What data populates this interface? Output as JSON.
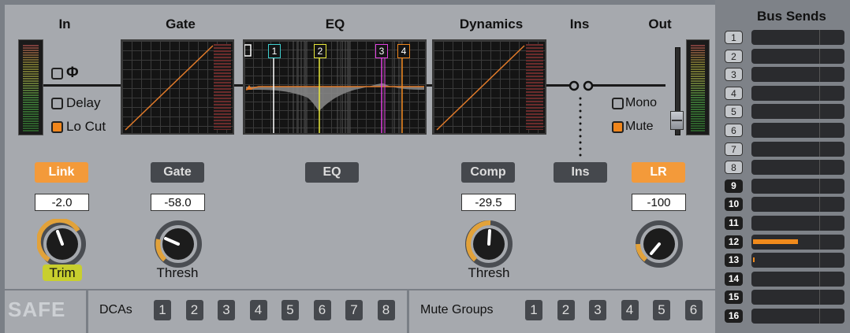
{
  "headers": {
    "in": "In",
    "gate": "Gate",
    "eq": "EQ",
    "dynamics": "Dynamics",
    "ins": "Ins",
    "out": "Out",
    "bus_sends": "Bus Sends"
  },
  "checkboxes": {
    "phase": {
      "label": "Φ",
      "on": false
    },
    "delay": {
      "label": "Delay",
      "on": false
    },
    "lo_cut": {
      "label": "Lo Cut",
      "on": true
    },
    "mono": {
      "label": "Mono",
      "on": false
    },
    "mute": {
      "label": "Mute",
      "on": true
    }
  },
  "buttons": {
    "link": {
      "label": "Link",
      "on": true
    },
    "gate": {
      "label": "Gate",
      "on": false
    },
    "eq": {
      "label": "EQ",
      "on": false
    },
    "comp": {
      "label": "Comp",
      "on": false
    },
    "ins": {
      "label": "Ins",
      "on": false
    },
    "lr": {
      "label": "LR",
      "on": true
    }
  },
  "values": {
    "trim": "-2.0",
    "gate_thresh": "-58.0",
    "comp_thresh": "-29.5",
    "pan": "-100"
  },
  "knob_labels": {
    "trim": "Trim",
    "gate_thresh": "Thresh",
    "comp_thresh": "Thresh"
  },
  "eq_bands": [
    "1",
    "2",
    "3",
    "4"
  ],
  "safe": "SAFE",
  "dcas": {
    "label": "DCAs",
    "items": [
      "1",
      "2",
      "3",
      "4",
      "5",
      "6",
      "7",
      "8"
    ]
  },
  "mute_groups": {
    "label": "Mute Groups",
    "items": [
      "1",
      "2",
      "3",
      "4",
      "5",
      "6"
    ]
  },
  "bus_sends": [
    {
      "n": "1",
      "active": false,
      "level": 0
    },
    {
      "n": "2",
      "active": false,
      "level": 0
    },
    {
      "n": "3",
      "active": false,
      "level": 0
    },
    {
      "n": "4",
      "active": false,
      "level": 0
    },
    {
      "n": "5",
      "active": false,
      "level": 0
    },
    {
      "n": "6",
      "active": false,
      "level": 0
    },
    {
      "n": "7",
      "active": false,
      "level": 0
    },
    {
      "n": "8",
      "active": false,
      "level": 0
    },
    {
      "n": "9",
      "active": true,
      "level": 0
    },
    {
      "n": "10",
      "active": true,
      "level": 0
    },
    {
      "n": "11",
      "active": true,
      "level": 0
    },
    {
      "n": "12",
      "active": true,
      "level": 0.5
    },
    {
      "n": "13",
      "active": true,
      "level": 0.02
    },
    {
      "n": "14",
      "active": true,
      "level": 0
    },
    {
      "n": "15",
      "active": true,
      "level": 0
    },
    {
      "n": "16",
      "active": true,
      "level": 0
    }
  ],
  "colors": {
    "accent": "#f0861c",
    "trim_highlight": "#c8cf2e",
    "eq_band1": "#3fd0d0",
    "eq_band2": "#e8e83a",
    "eq_band3": "#e040e0",
    "eq_band4": "#f0861c"
  }
}
